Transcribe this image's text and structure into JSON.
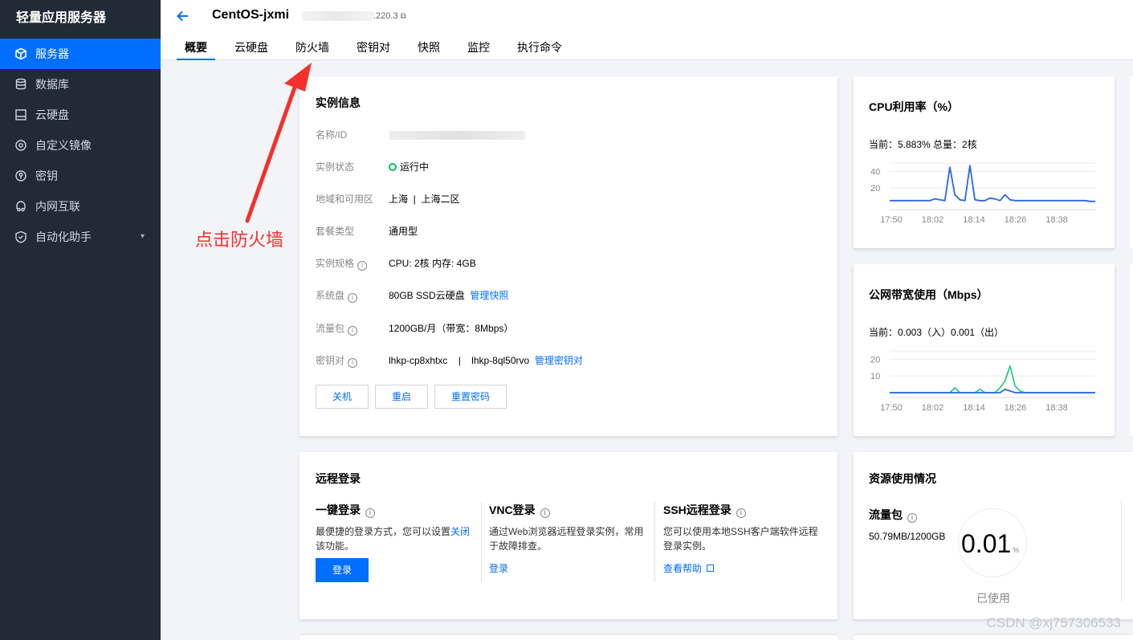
{
  "sidebar": {
    "brand": "轻量应用服务器",
    "items": [
      {
        "label": "服务器",
        "icon": "cube-icon"
      },
      {
        "label": "数据库",
        "icon": "database-icon"
      },
      {
        "label": "云硬盘",
        "icon": "disk-icon"
      },
      {
        "label": "自定义镜像",
        "icon": "image-icon"
      },
      {
        "label": "密钥",
        "icon": "key-icon"
      },
      {
        "label": "内网互联",
        "icon": "link-icon"
      },
      {
        "label": "自动化助手",
        "icon": "shield-icon"
      }
    ]
  },
  "header": {
    "title": "CentOS-jxmi",
    "title_suffix": ".220.3",
    "tabs": [
      "概要",
      "云硬盘",
      "防火墙",
      "密钥对",
      "快照",
      "监控",
      "执行命令"
    ]
  },
  "instance_info": {
    "title": "实例信息",
    "rows": {
      "name_label": "名称/ID",
      "status_label": "实例状态",
      "status_value": "运行中",
      "region_label": "地域和可用区",
      "region_value": "上海  |  上海二区",
      "plan_label": "套餐类型",
      "plan_value": "通用型",
      "spec_label": "实例规格",
      "spec_value": "CPU: 2核 内存: 4GB",
      "disk_label": "系统盘",
      "disk_value": "80GB SSD云硬盘",
      "disk_link": "管理快照",
      "traffic_label": "流量包",
      "traffic_value": "1200GB/月（带宽：8Mbps）",
      "keypair_label": "密钥对",
      "keypair_value": "lhkp-cp8xhtxc    |    lhkp-8ql50rvo",
      "keypair_link": "管理密钥对"
    },
    "buttons": {
      "shutdown": "关机",
      "restart": "重启",
      "reset_password": "重置密码"
    }
  },
  "cpu_card": {
    "title": "CPU利用率（%）",
    "current": "当前：5.883% 总量：2核"
  },
  "bandwidth_card": {
    "title": "公网带宽使用（Mbps）",
    "current": "当前：0.003（入）0.001（出）"
  },
  "remote_login": {
    "title": "远程登录",
    "one_click": {
      "title": "一键登录",
      "desc_pre": "最便捷的登录方式，您可以设置",
      "desc_link": "关闭",
      "desc_post": "该功能。",
      "button": "登录"
    },
    "vnc": {
      "title": "VNC登录",
      "desc": "通过Web浏览器远程登录实例，常用于故障排查。",
      "link": "登录"
    },
    "ssh": {
      "title": "SSH远程登录",
      "desc": "您可以使用本地SSH客户端软件远程登录实例。",
      "link": "查看帮助"
    }
  },
  "resource_usage": {
    "title": "资源使用情况",
    "traffic_label": "流量包",
    "traffic_value": "50.79MB/1200GB",
    "percent_value": "0.01",
    "percent_unit": "%",
    "used_label": "已使用"
  },
  "annotation": {
    "text": "点击防火墙"
  },
  "watermark": "CSDN @xj757306533",
  "chart_data": [
    {
      "type": "line",
      "x": [
        "17:50",
        "18:02",
        "18:14",
        "18:26",
        "18:38"
      ],
      "ylim": [
        0,
        50
      ],
      "yticks": [
        20,
        40
      ],
      "series": [
        {
          "values": [
            5,
            5,
            5,
            5,
            5,
            5,
            5,
            5,
            5,
            7,
            6,
            5,
            45,
            12,
            6,
            5,
            47,
            6,
            5,
            5,
            8,
            7,
            5,
            12,
            6,
            5,
            5,
            5,
            5,
            5,
            5,
            5,
            5,
            5,
            5,
            5,
            5,
            5,
            5,
            5,
            4,
            4
          ]
        }
      ]
    },
    {
      "type": "line",
      "x": [
        "17:50",
        "18:02",
        "18:14",
        "18:26",
        "18:38"
      ],
      "ylim": [
        0,
        25
      ],
      "yticks": [
        10,
        20
      ],
      "series": [
        {
          "values": [
            0,
            0,
            0,
            0,
            0,
            0,
            0,
            0,
            0,
            0,
            0,
            0,
            0,
            3,
            0,
            0,
            0,
            0,
            2,
            0,
            0,
            0,
            3,
            7,
            16,
            4,
            1,
            0,
            0,
            0,
            0,
            0,
            0,
            0,
            0,
            0,
            0,
            0,
            0,
            0,
            0,
            0
          ],
          "color": "#29cc85"
        },
        {
          "values": [
            0,
            0,
            0,
            0,
            0,
            0,
            0,
            0,
            0,
            0,
            0,
            0,
            0,
            0,
            0,
            0,
            0,
            0,
            0,
            0,
            0,
            0,
            0,
            2,
            1,
            0,
            0,
            0,
            0,
            0,
            0,
            0,
            0,
            0,
            0,
            0,
            0,
            0,
            0,
            0,
            0,
            0
          ],
          "color": "#2966e6"
        }
      ]
    }
  ]
}
